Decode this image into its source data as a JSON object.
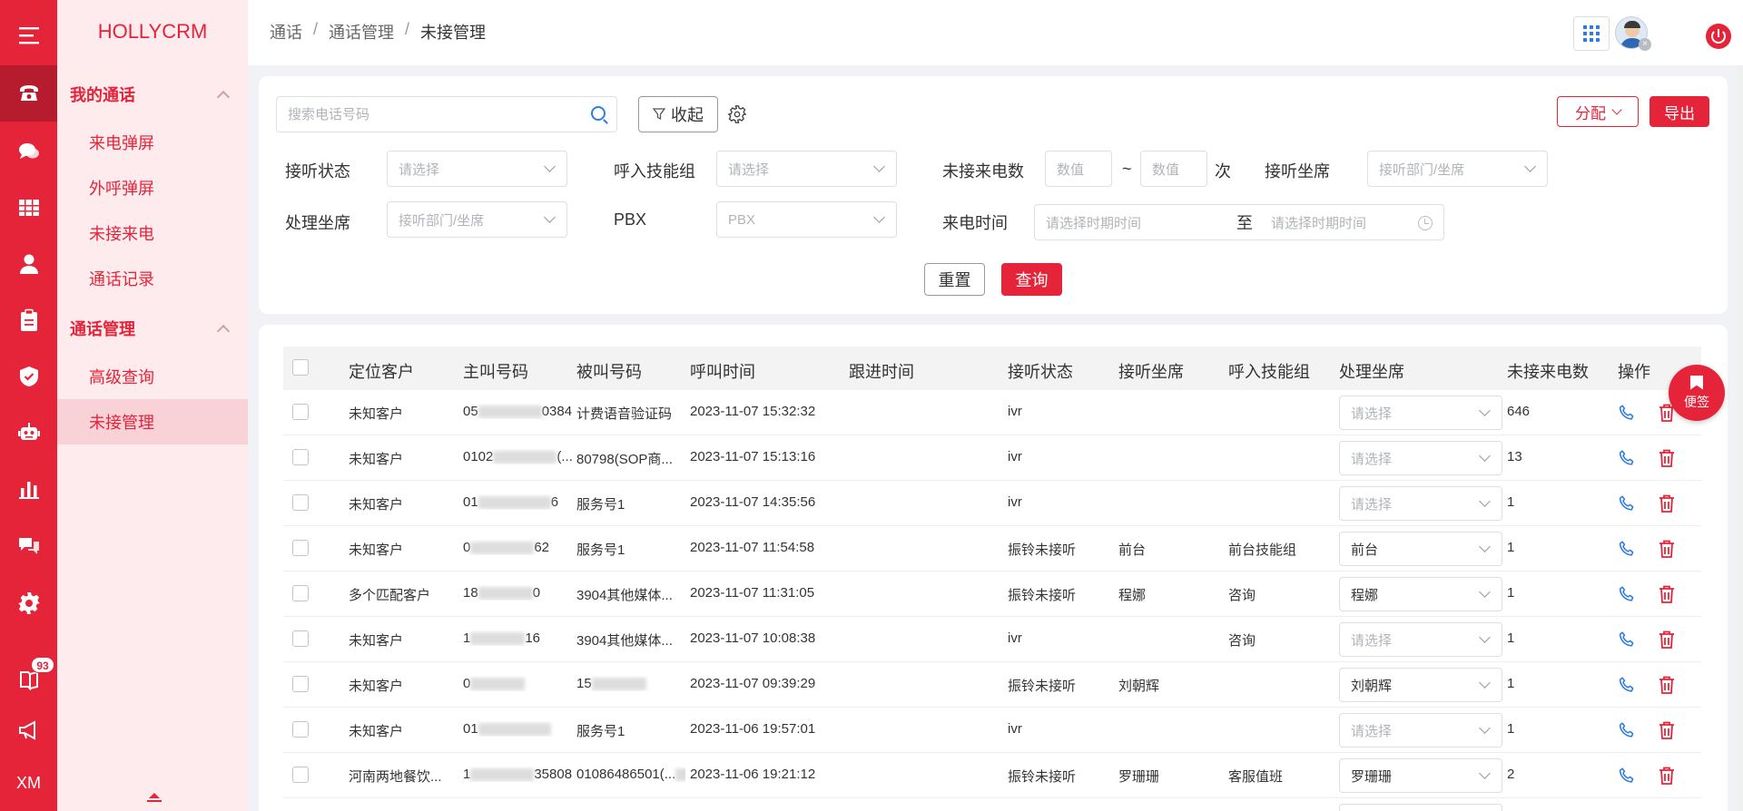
{
  "rail": {
    "badge_count": "93",
    "bottom_label": "XM",
    "icons": [
      "menu-icon",
      "phone-icon",
      "chat-icon",
      "grid-icon",
      "user-icon",
      "clipboard-icon",
      "shield-icon",
      "robot-icon",
      "bar-chart-icon",
      "message-icon",
      "gear-icon",
      "book-icon",
      "megaphone-icon"
    ]
  },
  "menu": {
    "brand": "HOLLYCRM",
    "groups": [
      {
        "label": "我的通话",
        "items": [
          "来电弹屏",
          "外呼弹屏",
          "未接来电",
          "通话记录"
        ]
      },
      {
        "label": "通话管理",
        "items": [
          "高级查询",
          "未接管理"
        ]
      }
    ]
  },
  "breadcrumb": [
    "通话",
    "通话管理",
    "未接管理"
  ],
  "filter": {
    "search_placeholder": "搜索电话号码",
    "collapse_label": "收起",
    "assign_label": "分配",
    "export_label": "导出",
    "answer_status_label": "接听状态",
    "answer_status_placeholder": "请选择",
    "skill_group_label": "呼入技能组",
    "skill_group_placeholder": "请选择",
    "missed_count_label": "未接来电数",
    "min_placeholder": "数值",
    "range_sep": "~",
    "max_placeholder": "数值",
    "times_unit": "次",
    "answer_agent_label": "接听坐席",
    "answer_agent_placeholder": "接听部门/坐席",
    "handle_agent_label": "处理坐席",
    "handle_agent_placeholder": "接听部门/坐席",
    "pbx_label": "PBX",
    "pbx_placeholder": "PBX",
    "call_time_label": "来电时间",
    "start_placeholder": "请选择时期时间",
    "to_label": "至",
    "end_placeholder": "请选择时期时间",
    "reset_label": "重置",
    "query_label": "查询"
  },
  "table": {
    "headers": [
      "定位客户",
      "主叫号码",
      "被叫号码",
      "呼叫时间",
      "跟进时间",
      "接听状态",
      "接听坐席",
      "呼入技能组",
      "处理坐席",
      "未接来电数",
      "操作"
    ],
    "select_placeholder": "请选择",
    "rows": [
      {
        "customer": "未知客户",
        "caller": "05",
        "caller_tail": "0384...",
        "callee": "计费语音验证码",
        "time": "2023-11-07 15:32:32",
        "followup": "",
        "status": "ivr",
        "agent": "",
        "group": "",
        "handler": "",
        "count": "646"
      },
      {
        "customer": "未知客户",
        "caller": "0102",
        "caller_tail": "(...",
        "callee": "80798(SOP商...",
        "time": "2023-11-07 15:13:16",
        "followup": "",
        "status": "ivr",
        "agent": "",
        "group": "",
        "handler": "",
        "count": "13"
      },
      {
        "customer": "未知客户",
        "caller": "01",
        "caller_tail": "6",
        "callee": "服务号1",
        "time": "2023-11-07 14:35:56",
        "followup": "",
        "status": "ivr",
        "agent": "",
        "group": "",
        "handler": "",
        "count": "1"
      },
      {
        "customer": "未知客户",
        "caller": "0",
        "caller_tail": "62",
        "callee": "服务号1",
        "time": "2023-11-07 11:54:58",
        "followup": "",
        "status": "振铃未接听",
        "agent": "前台",
        "group": "前台技能组",
        "handler": "前台",
        "count": "1"
      },
      {
        "customer": "多个匹配客户",
        "caller": "18",
        "caller_tail": "0",
        "callee": "3904其他媒体...",
        "time": "2023-11-07 11:31:05",
        "followup": "",
        "status": "振铃未接听",
        "agent": "程娜",
        "group": "咨询",
        "handler": "程娜",
        "count": "1"
      },
      {
        "customer": "未知客户",
        "caller": "1",
        "caller_tail": "16",
        "callee": "3904其他媒体...",
        "time": "2023-11-07 10:08:38",
        "followup": "",
        "status": "ivr",
        "agent": "",
        "group": "咨询",
        "handler": "",
        "count": "1"
      },
      {
        "customer": "未知客户",
        "caller": "0",
        "caller_tail": "",
        "callee": "15",
        "time": "2023-11-07 09:39:29",
        "followup": "",
        "status": "振铃未接听",
        "agent": "刘朝辉",
        "group": "",
        "handler": "刘朝辉",
        "count": "1"
      },
      {
        "customer": "未知客户",
        "caller": "01",
        "caller_tail": "",
        "callee": "服务号1",
        "time": "2023-11-06 19:57:01",
        "followup": "",
        "status": "ivr",
        "agent": "",
        "group": "",
        "handler": "",
        "count": "1"
      },
      {
        "customer": "河南两地餐饮...",
        "caller": "1",
        "caller_tail": "35808",
        "callee": "01086486501(...",
        "time": "2023-11-06 19:21:12",
        "followup": "",
        "status": "振铃未接听",
        "agent": "罗珊珊",
        "group": "客服值班",
        "handler": "罗珊珊",
        "count": "2"
      }
    ]
  },
  "float_tag_label": "便签",
  "colors": {
    "accent": "#e5243a",
    "link_blue": "#2f7de1"
  }
}
